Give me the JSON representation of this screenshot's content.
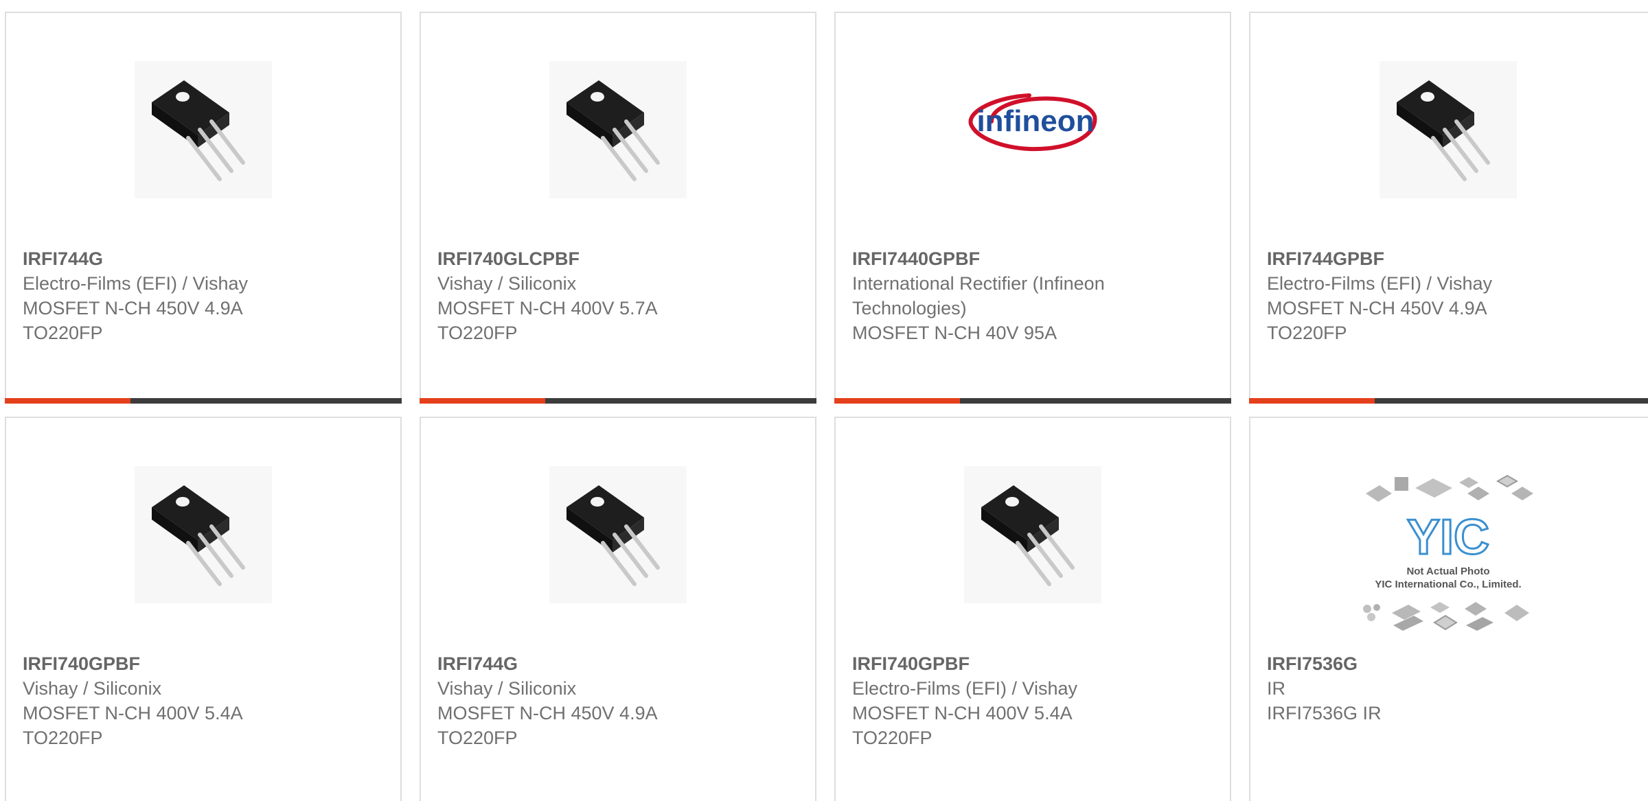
{
  "products": [
    {
      "part": "IRFI744G",
      "manufacturer": "Electro-Films (EFI) / Vishay",
      "description": "MOSFET N-CH 450V 4.9A",
      "package": "TO220FP",
      "image": "to220-transistor-icon"
    },
    {
      "part": "IRFI740GLCPBF",
      "manufacturer": "Vishay / Siliconix",
      "description": "MOSFET N-CH 400V 5.7A",
      "package": "TO220FP",
      "image": "to220-transistor-icon"
    },
    {
      "part": "IRFI7440GPBF",
      "manufacturer": "International Rectifier (Infineon Technologies)",
      "description": "MOSFET N-CH 40V 95A",
      "package": "",
      "image": "infineon-logo",
      "logo_text": "infineon"
    },
    {
      "part": "IRFI744GPBF",
      "manufacturer": "Electro-Films (EFI) / Vishay",
      "description": "MOSFET N-CH 450V 4.9A",
      "package": "TO220FP",
      "image": "to220-transistor-icon"
    },
    {
      "part": "IRFI740GPBF",
      "manufacturer": "Vishay / Siliconix",
      "description": "MOSFET N-CH 400V 5.4A",
      "package": "TO220FP",
      "image": "to220-transistor-icon"
    },
    {
      "part": "IRFI744G",
      "manufacturer": "Vishay / Siliconix",
      "description": "MOSFET N-CH 450V 4.9A",
      "package": "TO220FP",
      "image": "to220-transistor-icon"
    },
    {
      "part": "IRFI740GPBF",
      "manufacturer": "Electro-Films (EFI) / Vishay",
      "description": "MOSFET N-CH 400V 5.4A",
      "package": "TO220FP",
      "image": "to220-transistor-icon"
    },
    {
      "part": "IRFI7536G",
      "manufacturer": "IR",
      "description": "IRFI7536G IR",
      "package": "",
      "image": "yic-placeholder-image",
      "placeholder_line1": "Not Actual Photo",
      "placeholder_line2": "YIC International Co., Limited.",
      "placeholder_logo": "YIC"
    }
  ],
  "colors": {
    "accent": "#e5401c",
    "bar": "#3c3c3c",
    "text": "#707070",
    "border": "#dedede",
    "infineon_blue": "#1f4e9c",
    "infineon_red": "#d0102a"
  }
}
